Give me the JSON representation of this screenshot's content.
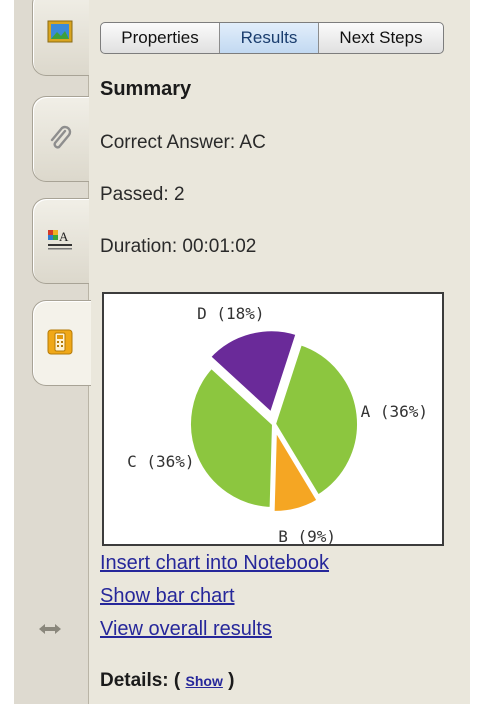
{
  "tabs": [
    {
      "label": "Properties",
      "selected": false
    },
    {
      "label": "Results",
      "selected": true
    },
    {
      "label": "Next Steps",
      "selected": false
    }
  ],
  "side_tabs": [
    {
      "icon": "gallery-icon"
    },
    {
      "icon": "paperclip-icon"
    },
    {
      "icon": "properties-icon"
    },
    {
      "icon": "response-clicker-icon",
      "active": true
    }
  ],
  "summary": {
    "title": "Summary",
    "correct_answer_label": "Correct Answer: ",
    "correct_answer": "AC",
    "passed_label": "Passed: ",
    "passed": "2",
    "duration_label": "Duration: ",
    "duration": "00:01:02"
  },
  "chart_data": {
    "type": "pie",
    "slices": [
      {
        "label": "A",
        "display": "A (36%)",
        "value": 36,
        "color": "#8cc63f"
      },
      {
        "label": "B",
        "display": "B (9%)",
        "value": 9,
        "color": "#f5a623"
      },
      {
        "label": "C",
        "display": "C (36%)",
        "value": 36,
        "color": "#8cc63f"
      },
      {
        "label": "D",
        "display": "D (18%)",
        "value": 18,
        "color": "#6a2a99"
      }
    ]
  },
  "links": {
    "insert_chart": "Insert chart into Notebook",
    "show_bar_chart": "Show bar chart",
    "view_overall": "View overall results"
  },
  "details": {
    "label": "Details:",
    "open_paren": " ( ",
    "show": "Show",
    "close_paren": " )"
  },
  "colors": {
    "panel_bg": "#eae7dc",
    "link": "#26279a",
    "selected_tab": "#c2d9f1"
  }
}
